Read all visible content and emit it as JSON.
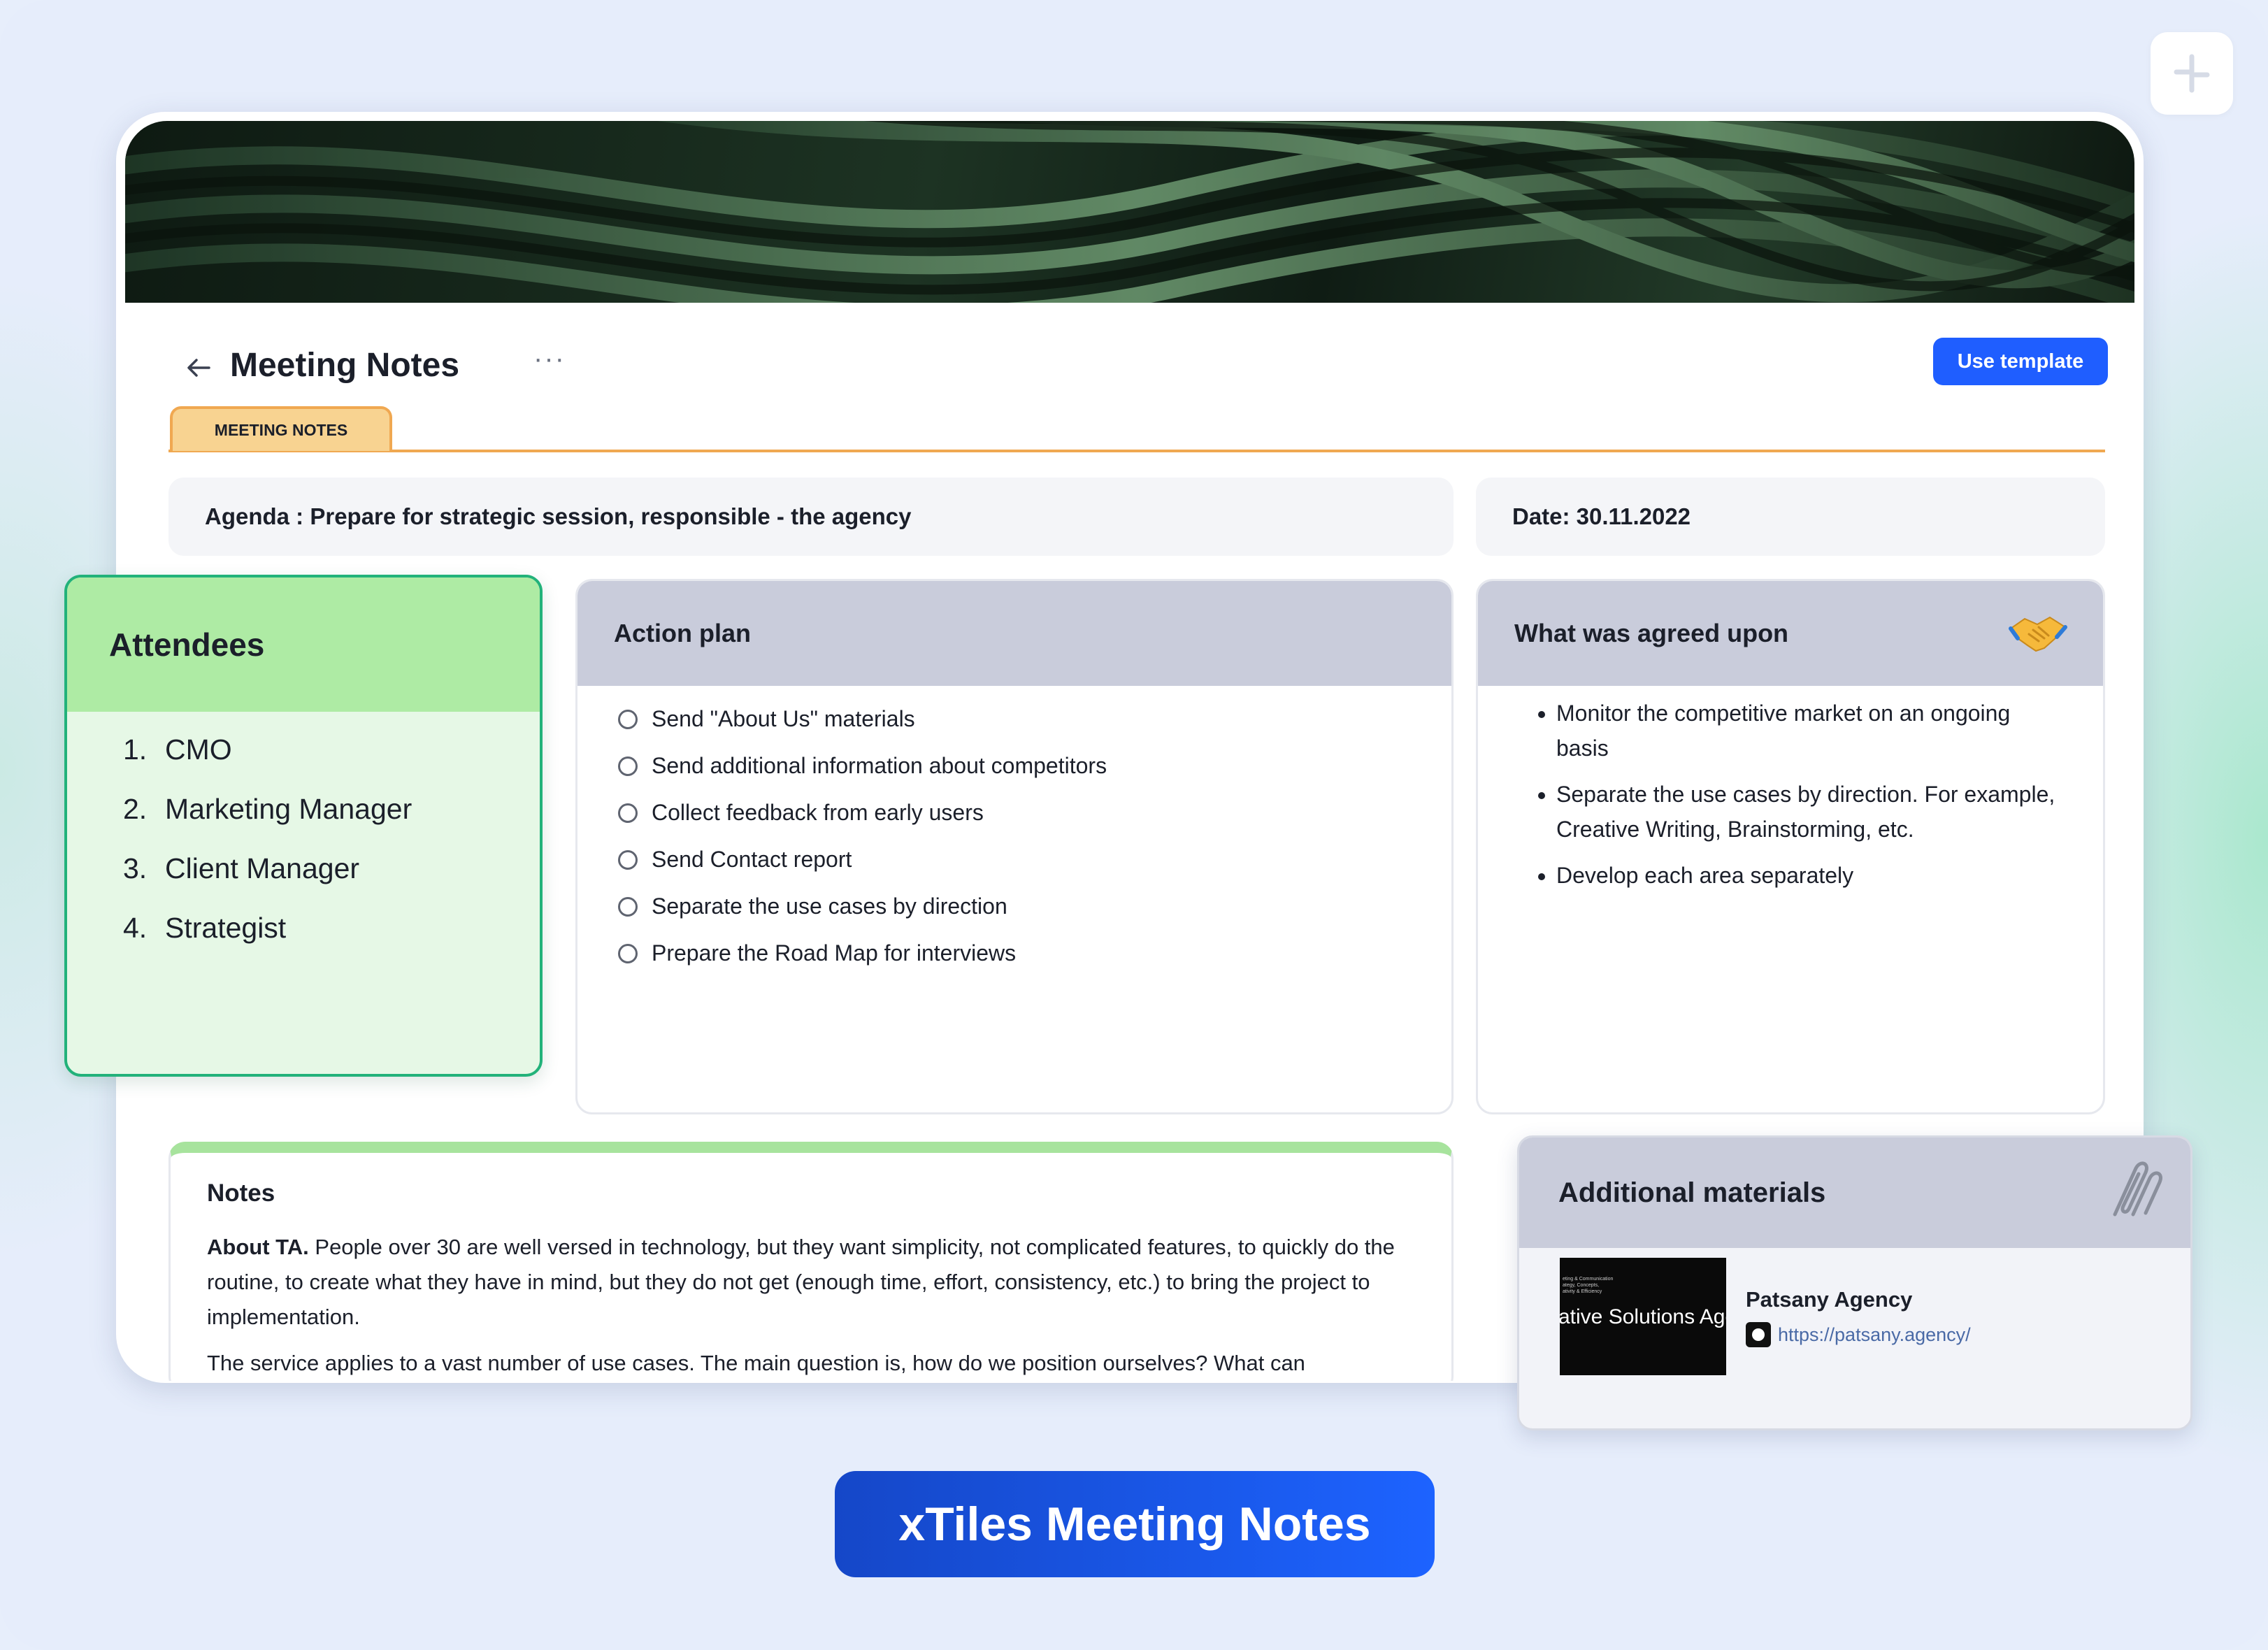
{
  "page": {
    "title": "Meeting Notes",
    "more_label": "···",
    "use_template_label": "Use template",
    "tab_label": "MEETING NOTES"
  },
  "agenda": "Agenda : Prepare for strategic session, responsible - the agency",
  "date": "Date: 30.11.2022",
  "attendees": {
    "title": "Attendees",
    "items": [
      {
        "num": "1.",
        "label": "CMO"
      },
      {
        "num": "2.",
        "label": "Marketing Manager"
      },
      {
        "num": "3.",
        "label": "Client Manager"
      },
      {
        "num": "4.",
        "label": "Strategist"
      }
    ]
  },
  "action_plan": {
    "title": "Action plan",
    "items": [
      "Send \"About Us\" materials",
      "Send additional information about competitors",
      "Collect feedback from early users",
      "Send Contact report",
      "Separate the use cases by direction",
      "Prepare the Road Map for interviews"
    ]
  },
  "agreed": {
    "title": "What was agreed upon",
    "icon": "handshake-icon",
    "items": [
      "Monitor the competitive market on an ongoing basis",
      "Separate the use cases by direction. For example, Creative Writing, Brainstorming, etc.",
      "Develop each area separately"
    ]
  },
  "notes": {
    "title": "Notes",
    "lead": "About TA.",
    "para1": " People over 30 are well versed in technology, but they want simplicity, not complicated features, to quickly do the routine, to create what they have in mind, but they do not get (enough time, effort, consistency, etc.) to bring the project to implementation.",
    "para2": "The service applies to a vast number of use cases. The main question is, how do we position ourselves? What can"
  },
  "materials": {
    "title": "Additional materials",
    "icon": "paperclip-icon",
    "link_title": "Patsany Agency",
    "link_url": "https://patsany.agency/",
    "thumb_text": "ative Solutions Age",
    "thumb_small": "eting & Communication\nategy, Concepts,\nativity & Efficiency"
  },
  "banner": "xTiles Meeting Notes",
  "colors": {
    "accent": "#1f5eff",
    "tab": "#f8d391",
    "tab_border": "#f0a851",
    "attendees_bg": "#e6f8e6",
    "attendees_head": "#aeeba4",
    "attendees_border": "#22b27a",
    "card_head": "#c9ccdb"
  }
}
